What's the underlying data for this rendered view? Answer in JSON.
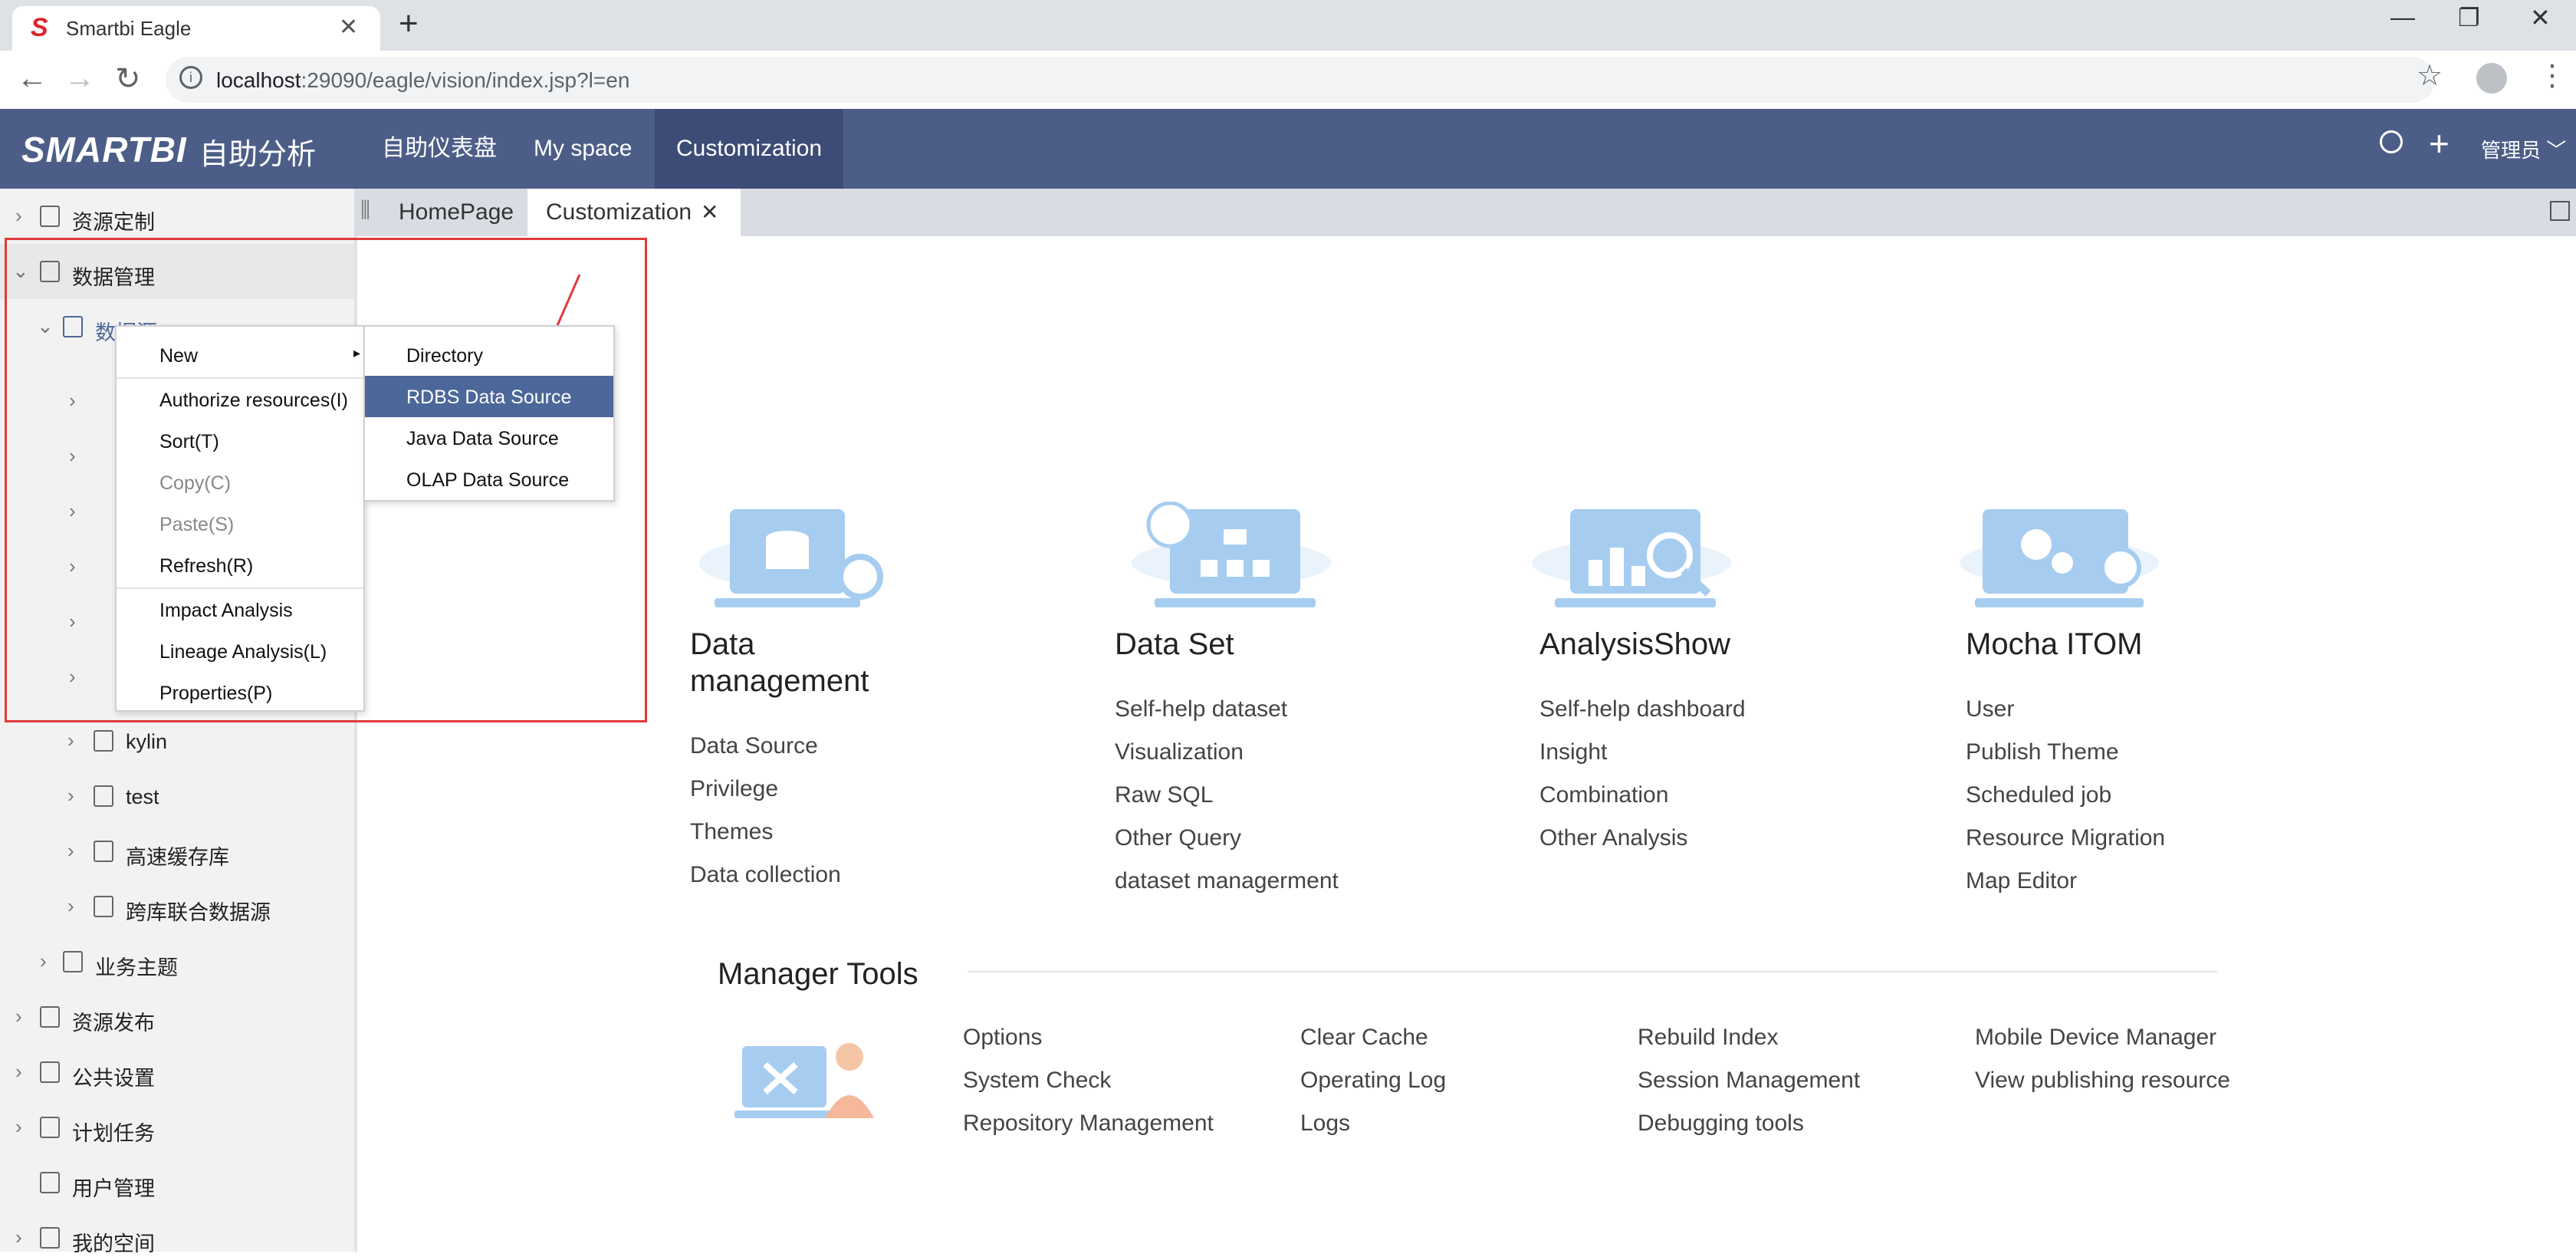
{
  "browser": {
    "tab_title": "Smartbi Eagle",
    "url_host": "localhost",
    "url_path": ":29090/eagle/vision/index.jsp?l=en"
  },
  "header": {
    "logo": "SMARTBI",
    "logo_sub": "自助分析",
    "nav": [
      "自助仪表盘",
      "My space",
      "Customization"
    ],
    "user": "管理员"
  },
  "sidebar": {
    "items": [
      {
        "label": "资源定制"
      },
      {
        "label": "数据管理"
      },
      {
        "label": "数据源"
      },
      {
        "label": "kylin"
      },
      {
        "label": "test"
      },
      {
        "label": "高速缓存库"
      },
      {
        "label": "跨库联合数据源"
      },
      {
        "label": "业务主题"
      },
      {
        "label": "资源发布"
      },
      {
        "label": "公共设置"
      },
      {
        "label": "计划任务"
      },
      {
        "label": "用户管理"
      },
      {
        "label": "我的空间"
      }
    ]
  },
  "content_tabs": [
    "HomePage",
    "Customization"
  ],
  "cards": [
    {
      "title": "Data management",
      "links": [
        "Data Source",
        "Privilege",
        "Themes",
        "Data collection"
      ]
    },
    {
      "title": "Data Set",
      "links": [
        "Self-help dataset",
        "Visualization",
        "Raw SQL",
        "Other Query",
        "dataset managerment"
      ]
    },
    {
      "title": "AnalysisShow",
      "links": [
        "Self-help dashboard",
        "Insight",
        "Combination",
        "Other Analysis"
      ]
    },
    {
      "title": "Mocha ITOM",
      "links": [
        "User",
        "Publish Theme",
        "Scheduled job",
        "Resource Migration",
        "Map Editor"
      ]
    }
  ],
  "manager_tools": {
    "title": "Manager Tools",
    "columns": [
      [
        "Options",
        "System Check",
        "Repository Management"
      ],
      [
        "Clear Cache",
        "Operating Log",
        "Logs"
      ],
      [
        "Rebuild Index",
        "Session Management",
        "Debugging tools"
      ],
      [
        "Mobile Device Manager",
        "View publishing resource"
      ]
    ]
  },
  "context_menu": {
    "items": [
      "New",
      "Authorize resources(I)",
      "Sort(T)",
      "Copy(C)",
      "Paste(S)",
      "Refresh(R)",
      "Impact Analysis",
      "Lineage Analysis(L)",
      "Properties(P)"
    ]
  },
  "submenu": {
    "items": [
      "Directory",
      "RDBS Data Source",
      "Java Data Source",
      "OLAP Data Source"
    ],
    "selected": "RDBS Data Source"
  },
  "colors": {
    "header": "#4c5e88",
    "highlight": "#e03a3a",
    "selected": "#4c6799"
  }
}
